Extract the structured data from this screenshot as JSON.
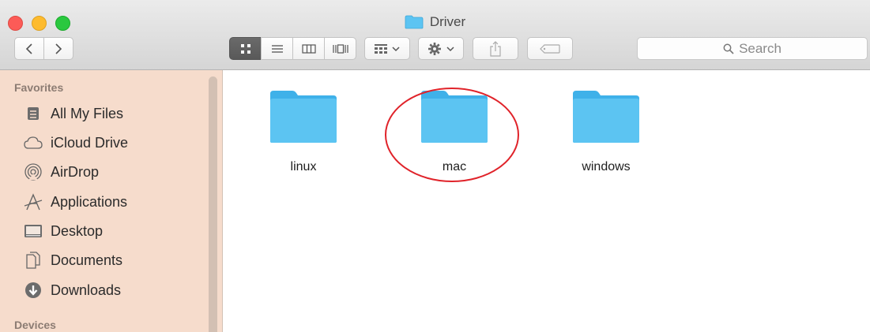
{
  "window": {
    "title": "Driver"
  },
  "toolbar": {
    "search_placeholder": "Search",
    "view_modes": [
      "icon-view",
      "list-view",
      "column-view",
      "cover-flow-view"
    ],
    "active_view": "icon-view"
  },
  "sidebar": {
    "favorites_header": "Favorites",
    "items": [
      {
        "label": "All My Files",
        "icon": "all-files-icon"
      },
      {
        "label": "iCloud Drive",
        "icon": "cloud-icon"
      },
      {
        "label": "AirDrop",
        "icon": "airdrop-icon"
      },
      {
        "label": "Applications",
        "icon": "applications-icon"
      },
      {
        "label": "Desktop",
        "icon": "desktop-icon"
      },
      {
        "label": "Documents",
        "icon": "documents-icon"
      },
      {
        "label": "Downloads",
        "icon": "downloads-icon"
      }
    ],
    "devices_header": "Devices"
  },
  "content": {
    "folders": [
      {
        "name": "linux"
      },
      {
        "name": "mac",
        "highlighted": true
      },
      {
        "name": "windows"
      }
    ]
  },
  "colors": {
    "folder_blue": "#5cc4f2",
    "sidebar_bg": "#f6dccc",
    "highlight_red": "#e0232a"
  }
}
